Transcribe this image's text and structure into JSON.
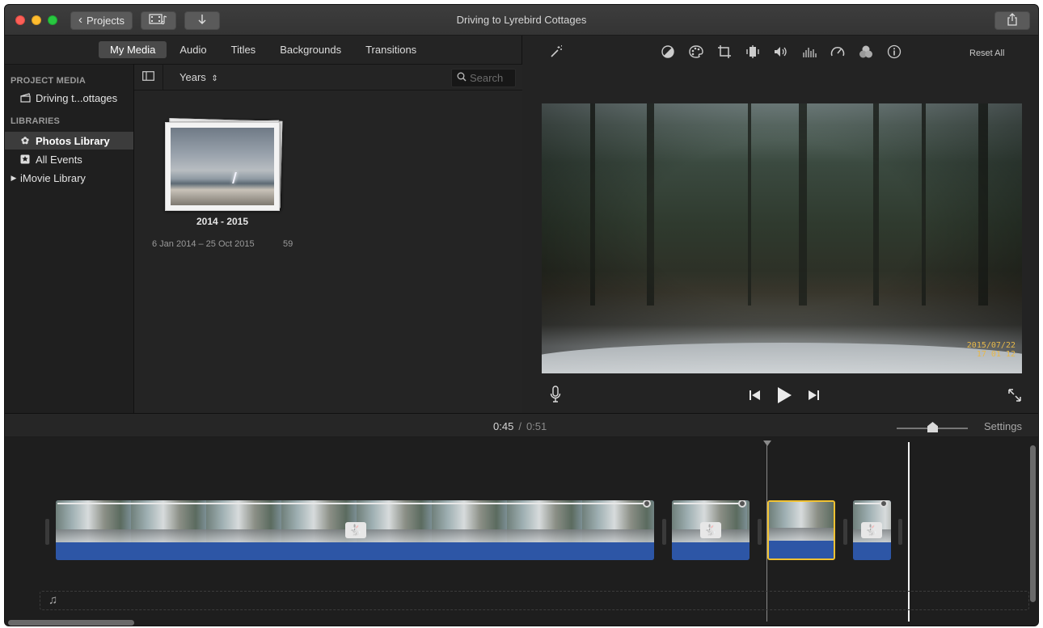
{
  "window": {
    "title": "Driving to Lyrebird Cottages"
  },
  "toolbar": {
    "projects_label": "Projects",
    "media_icon": "film-music-icon",
    "import_icon": "download-arrow-icon",
    "share_icon": "share-icon"
  },
  "media_tabs": [
    {
      "label": "My Media",
      "active": true
    },
    {
      "label": "Audio",
      "active": false
    },
    {
      "label": "Titles",
      "active": false
    },
    {
      "label": "Backgrounds",
      "active": false
    },
    {
      "label": "Transitions",
      "active": false
    }
  ],
  "sidebar": {
    "project_media_heading": "PROJECT MEDIA",
    "project_item": "Driving t...ottages",
    "libraries_heading": "LIBRARIES",
    "items": [
      {
        "label": "Photos Library",
        "icon": "photos-icon",
        "selected": true
      },
      {
        "label": "All Events",
        "icon": "star-icon",
        "selected": false
      },
      {
        "label": "iMovie Library",
        "icon": "disclosure-triangle-icon",
        "selected": false
      }
    ]
  },
  "browser": {
    "grouping": "Years",
    "search_placeholder": "Search",
    "event": {
      "title": "2014 - 2015",
      "date_range": "6 Jan 2014 – 25 Oct 2015",
      "count": "59"
    }
  },
  "viewer": {
    "reset_label": "Reset All",
    "adjust_icons": [
      "magic-wand-icon",
      "color-balance-icon",
      "color-correction-icon",
      "crop-icon",
      "stabilization-icon",
      "volume-icon",
      "equalizer-icon",
      "speed-icon",
      "clip-filter-icon",
      "info-icon"
    ],
    "timestamp_date": "2015/07/22",
    "timestamp_time": "17 01 12"
  },
  "timeline": {
    "current_time": "0:45",
    "separator": "/",
    "total_time": "0:51",
    "settings_label": "Settings",
    "zoom_level": 0.5,
    "clips": [
      {
        "speed": "fast",
        "selected": false
      },
      {
        "speed": "fast",
        "selected": false
      },
      {
        "speed": "normal",
        "selected": true
      },
      {
        "speed": "fast",
        "selected": false
      }
    ]
  }
}
